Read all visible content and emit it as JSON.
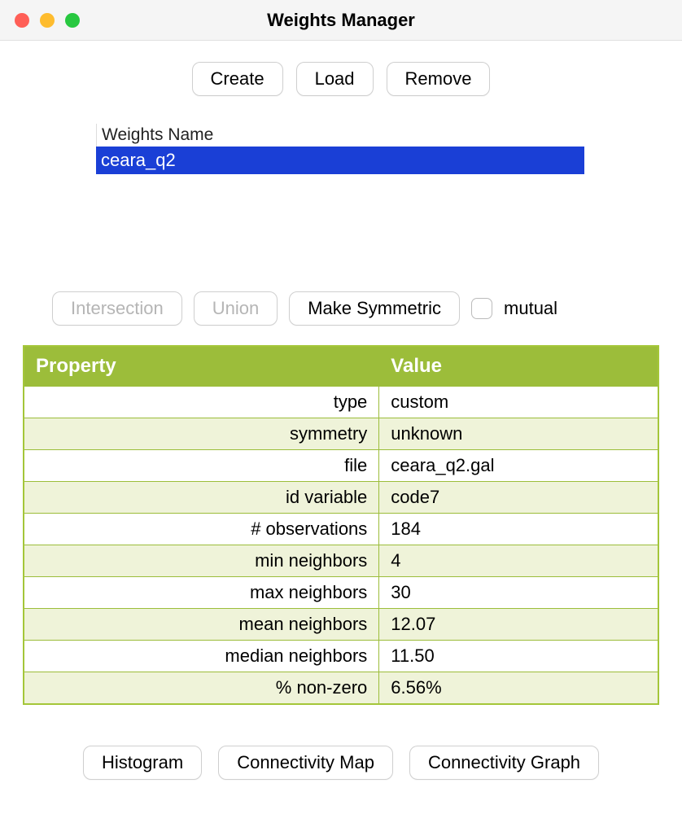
{
  "window": {
    "title": "Weights Manager"
  },
  "top_buttons": {
    "create": "Create",
    "load": "Load",
    "remove": "Remove"
  },
  "weights_list": {
    "header": "Weights Name",
    "selected": "ceara_q2"
  },
  "ops": {
    "intersection": "Intersection",
    "union": "Union",
    "make_symmetric": "Make Symmetric",
    "mutual_label": "mutual"
  },
  "table": {
    "header_property": "Property",
    "header_value": "Value",
    "rows": [
      {
        "property": "type",
        "value": "custom"
      },
      {
        "property": "symmetry",
        "value": "unknown"
      },
      {
        "property": "file",
        "value": "ceara_q2.gal"
      },
      {
        "property": "id variable",
        "value": "code7"
      },
      {
        "property": "# observations",
        "value": "184"
      },
      {
        "property": "min neighbors",
        "value": "4"
      },
      {
        "property": "max neighbors",
        "value": "30"
      },
      {
        "property": "mean neighbors",
        "value": "12.07"
      },
      {
        "property": "median neighbors",
        "value": "11.50"
      },
      {
        "property": "% non-zero",
        "value": "6.56%"
      }
    ]
  },
  "bottom_buttons": {
    "histogram": "Histogram",
    "connectivity_map": "Connectivity Map",
    "connectivity_graph": "Connectivity Graph"
  }
}
